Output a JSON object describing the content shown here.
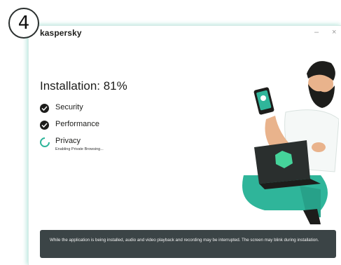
{
  "step_badge": "4",
  "window": {
    "brand": "kaspersky",
    "minimize_symbol": "–",
    "close_symbol": "×"
  },
  "install": {
    "title": "Installation: 81%",
    "progress_percent": 81,
    "steps": [
      {
        "label": "Security",
        "status": "done",
        "icon": "check-circle-icon"
      },
      {
        "label": "Performance",
        "status": "done",
        "icon": "check-circle-icon"
      },
      {
        "label": "Privacy",
        "status": "in-progress",
        "icon": "spinner-icon",
        "sublabel": "Enabling Private Browsing..."
      }
    ]
  },
  "notice": {
    "text": "While the application is being installed, audio and video playback and recording may be interrupted. The screen may blink during installation."
  },
  "colors": {
    "accent": "#2fb59a",
    "notice_bg": "#3b4446",
    "text": "#1d1d1b"
  }
}
